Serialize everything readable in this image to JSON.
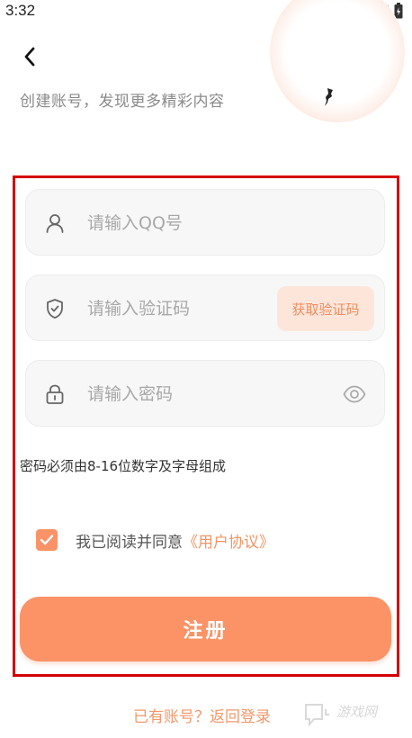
{
  "status_bar": {
    "time": "3:32"
  },
  "header": {
    "subtitle": "创建账号，发现更多精彩内容"
  },
  "form": {
    "qq_field": {
      "placeholder": "请输入QQ号",
      "icon": "user-icon"
    },
    "code_field": {
      "placeholder": "请输入验证码",
      "icon": "shield-icon",
      "get_code_label": "获取验证码"
    },
    "password_field": {
      "placeholder": "请输入密码",
      "icon": "lock-icon",
      "toggle_icon": "eye-icon"
    },
    "password_hint": "密码必须由8-16位数字及字母组成",
    "agreement": {
      "checked": true,
      "text": "我已阅读并同意",
      "link_text": "《用户协议》"
    },
    "register_label": "注册"
  },
  "footer": {
    "login_link": "已有账号？返回登录"
  },
  "watermark": {
    "text": "游戏网"
  },
  "colors": {
    "accent": "#fc9366",
    "accent_light": "#fde6d9",
    "link": "#f19565",
    "highlight_border": "#d40000"
  }
}
